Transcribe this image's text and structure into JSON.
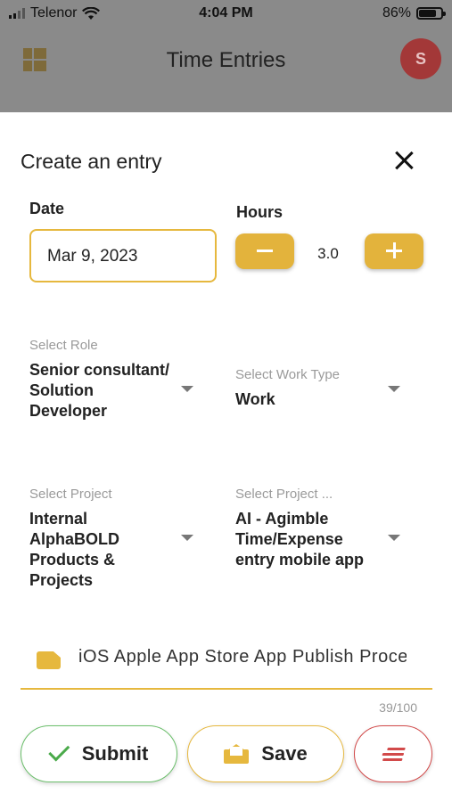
{
  "status_bar": {
    "carrier": "Telenor",
    "time": "4:04 PM",
    "battery_percent": "86%",
    "battery_level": 0.86,
    "icons": [
      "signal-icon",
      "wifi-icon",
      "battery-icon"
    ]
  },
  "app_bar": {
    "title": "Time Entries",
    "avatar_initial": "S",
    "menu_icon": "dashboard-grid-icon"
  },
  "modal": {
    "title": "Create an entry",
    "close_icon": "close-icon",
    "date": {
      "label": "Date",
      "value": "Mar 9, 2023"
    },
    "hours": {
      "label": "Hours",
      "value": "3.0",
      "decrement_icon": "minus-icon",
      "increment_icon": "plus-icon"
    },
    "role": {
      "label": "Select Role",
      "value": "Senior consultant/ Solution Developer"
    },
    "work_type": {
      "label": "Select Work Type",
      "value": "Work"
    },
    "project": {
      "label": "Select Project",
      "value": "Internal AlphaBOLD Products & Projects"
    },
    "project_task": {
      "label": "Select Project ...",
      "value": "AI - Agimble Time/Expense entry mobile app"
    },
    "description": {
      "value": "iOS Apple App Store App Publish Process",
      "counter": "39/100",
      "icon": "note-icon"
    },
    "buttons": {
      "submit": "Submit",
      "save": "Save",
      "menu_icon": "lines-menu-icon"
    }
  },
  "colors": {
    "accent": "#e3b33c",
    "submit_border": "#6bbf6b",
    "danger": "#d24a4a",
    "overlay": "#8a8a8a",
    "avatar": "#a33838"
  }
}
